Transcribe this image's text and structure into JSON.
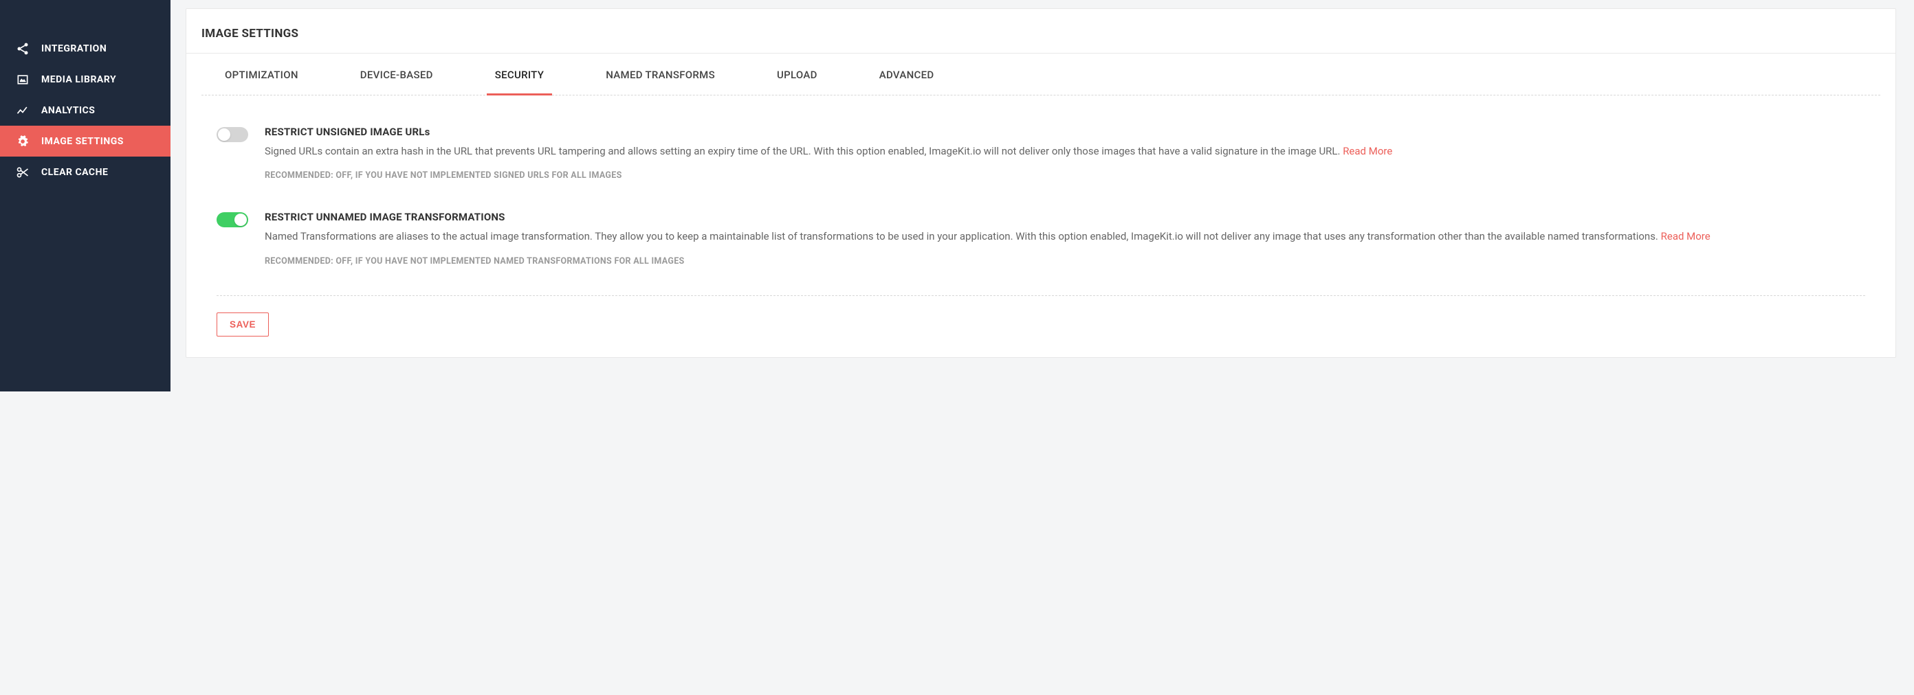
{
  "sidebar": {
    "items": [
      {
        "label": "INTEGRATION"
      },
      {
        "label": "MEDIA LIBRARY"
      },
      {
        "label": "ANALYTICS"
      },
      {
        "label": "IMAGE SETTINGS"
      },
      {
        "label": "CLEAR CACHE"
      }
    ]
  },
  "panel": {
    "title": "IMAGE SETTINGS"
  },
  "tabs": [
    {
      "label": "OPTIMIZATION"
    },
    {
      "label": "DEVICE-BASED"
    },
    {
      "label": "SECURITY"
    },
    {
      "label": "NAMED TRANSFORMS"
    },
    {
      "label": "UPLOAD"
    },
    {
      "label": "ADVANCED"
    }
  ],
  "settings": [
    {
      "title": "RESTRICT UNSIGNED IMAGE URLs",
      "desc": "Signed URLs contain an extra hash in the URL that prevents URL tampering and allows setting an expiry time of the URL. With this option enabled, ImageKit.io will not deliver only those images that have a valid signature in the image URL. ",
      "link": "Read More",
      "rec": "RECOMMENDED: OFF, IF YOU HAVE NOT IMPLEMENTED SIGNED URLS FOR ALL IMAGES",
      "on": false
    },
    {
      "title": "RESTRICT UNNAMED IMAGE TRANSFORMATIONS",
      "desc": "Named Transformations are aliases to the actual image transformation. They allow you to keep a maintainable list of transformations to be used in your application. With this option enabled, ImageKit.io will not deliver any image that uses any transformation other than the available named transformations. ",
      "link": "Read More",
      "rec": "RECOMMENDED: OFF, IF YOU HAVE NOT IMPLEMENTED NAMED TRANSFORMATIONS FOR ALL IMAGES",
      "on": true
    }
  ],
  "save": "SAVE"
}
